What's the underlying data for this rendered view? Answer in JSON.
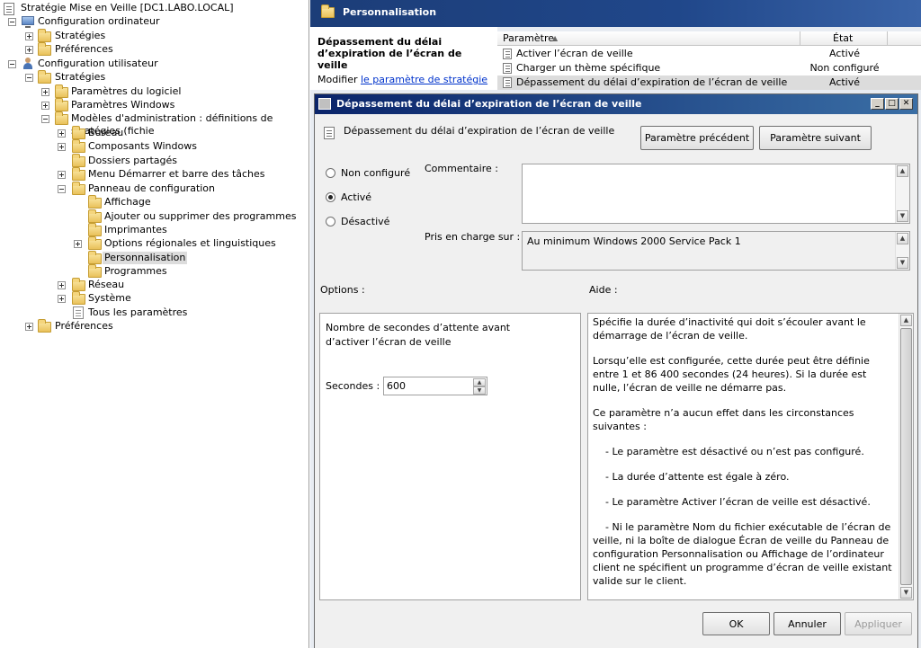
{
  "tree": {
    "root": "Stratégie Mise en Veille [DC1.LABO.LOCAL]",
    "nodes": [
      {
        "label": "Configuration ordinateur"
      },
      {
        "label": "Stratégies"
      },
      {
        "label": "Préférences"
      },
      {
        "label": "Configuration utilisateur"
      },
      {
        "label": "Stratégies"
      },
      {
        "label": "Paramètres du logiciel"
      },
      {
        "label": "Paramètres Windows"
      },
      {
        "label": "Modèles d'administration : définitions de stratégies (fichie"
      },
      {
        "label": "Bureau"
      },
      {
        "label": "Composants Windows"
      },
      {
        "label": "Dossiers partagés"
      },
      {
        "label": "Menu Démarrer et barre des tâches"
      },
      {
        "label": "Panneau de configuration"
      },
      {
        "label": "Affichage"
      },
      {
        "label": "Ajouter ou supprimer des programmes"
      },
      {
        "label": "Imprimantes"
      },
      {
        "label": "Options régionales et linguistiques"
      },
      {
        "label": "Personnalisation"
      },
      {
        "label": "Programmes"
      },
      {
        "label": "Réseau"
      },
      {
        "label": "Système"
      },
      {
        "label": "Tous les paramètres"
      },
      {
        "label": "Préférences"
      }
    ]
  },
  "header": {
    "title": "Personnalisation"
  },
  "description": {
    "title": "Dépassement du délai d’expiration de l’écran de veille",
    "edit_prefix": "Modifier",
    "edit_link": "le paramètre de stratégie"
  },
  "settings_list": {
    "col_setting": "Paramètre",
    "col_state": "État",
    "rows": [
      {
        "name": "Activer l’écran de veille",
        "state": "Activé"
      },
      {
        "name": "Charger un thème spécifique",
        "state": "Non configuré"
      },
      {
        "name": "Dépassement du délai d’expiration de l’écran de veille",
        "state": "Activé"
      }
    ]
  },
  "dialog": {
    "title": "Dépassement du délai d’expiration de l’écran de veille",
    "setting_name": "Dépassement du délai d’expiration de l’écran de veille",
    "prev_button": "Paramètre précédent",
    "next_button": "Paramètre suivant",
    "radio_not_configured": "Non configuré",
    "radio_enabled": "Activé",
    "radio_disabled": "Désactivé",
    "selected_state": "Activé",
    "comment_label": "Commentaire :",
    "comment_value": "",
    "supported_label": "Pris en charge sur :",
    "supported_value": "Au minimum Windows 2000 Service Pack 1",
    "options_label": "Options :",
    "help_label": "Aide :",
    "option_description": "Nombre de secondes d’attente avant d’activer l’écran de veille",
    "seconds_label": "Secondes :",
    "seconds_value": "600",
    "help_paragraphs": [
      "Spécifie la durée d’inactivité qui doit s’écouler avant le démarrage de l’écran de veille.",
      "Lorsqu’elle est configurée, cette durée peut être définie entre 1 et 86 400 secondes (24 heures). Si la durée est nulle, l’écran de veille ne démarre pas.",
      "Ce paramètre n’a aucun effet dans les circonstances suivantes :",
      "    - Le paramètre est désactivé ou n’est pas configuré.",
      "    - La durée d’attente est égale à zéro.",
      "    - Le paramètre Activer l’écran de veille est désactivé.",
      "    - Ni le paramètre Nom du fichier exécutable de l’écran de veille, ni la boîte de dialogue Écran de veille du Panneau de configuration Personnalisation ou Affichage de l’ordinateur client ne spécifient un programme d’écran de veille existant valide sur le client."
    ],
    "ok_button": "OK",
    "cancel_button": "Annuler",
    "apply_button": "Appliquer",
    "min_glyph": "_",
    "max_glyph": "□",
    "close_glyph": "✕"
  },
  "colors": {
    "header_band": "#20478a",
    "dialog_titlebar": "#0a246a",
    "link": "#0033cc",
    "selection": "#dcdcdc"
  }
}
